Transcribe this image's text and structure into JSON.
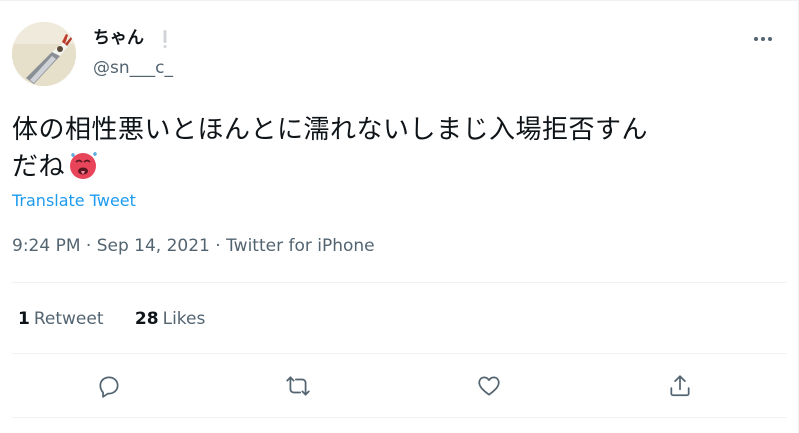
{
  "user": {
    "display_name": "ちゃん",
    "handle": "@sn___c_"
  },
  "tweet": {
    "text_line1": "体の相性悪いとほんとに濡れないしまじ入場拒否すん",
    "text_line2": "だね",
    "emoji": "hot-face-emoji",
    "translate_label": "Translate Tweet",
    "time": "9:24 PM",
    "separator": " · ",
    "date": "Sep 14, 2021",
    "source": "Twitter for iPhone"
  },
  "stats": {
    "retweets_count": "1",
    "retweets_label": "Retweet",
    "likes_count": "28",
    "likes_label": "Likes"
  },
  "icons": {
    "more": "more-icon",
    "reply": "reply-icon",
    "retweet": "retweet-icon",
    "like": "heart-icon",
    "share": "share-icon",
    "exclaim": "exclamation-icon"
  },
  "colors": {
    "link": "#1d9bf0",
    "secondary_text": "#536471",
    "primary_text": "#0f1419",
    "divider": "#eff3f4"
  }
}
